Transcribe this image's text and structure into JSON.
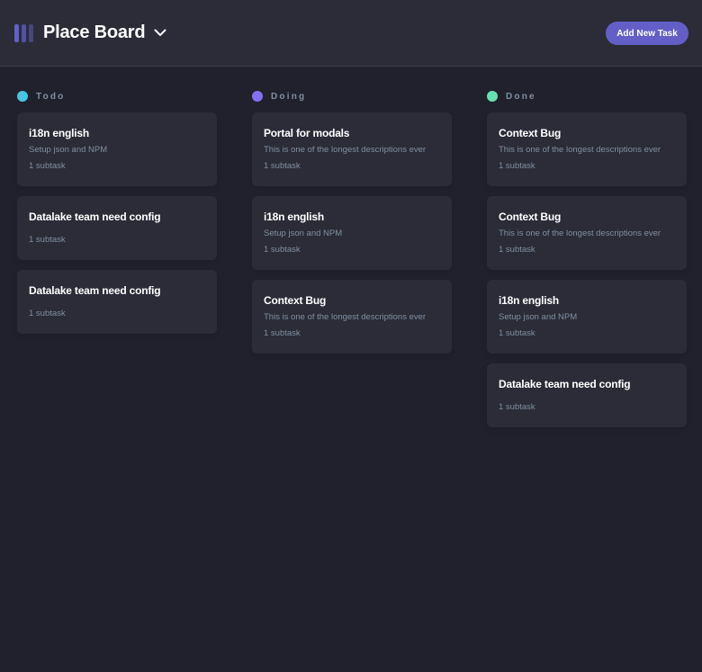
{
  "header": {
    "title": "Place Board",
    "add_task_label": "Add New Task",
    "logo_icon": "board-logo-icon",
    "dropdown_icon": "chevron-down-icon"
  },
  "columns": [
    {
      "name": "Todo",
      "color": "#49c4e5",
      "tasks": [
        {
          "title": "i18n english",
          "description": "Setup json and NPM",
          "subtasks": "1 subtask"
        },
        {
          "title": "Datalake team need config",
          "description": "",
          "subtasks": "1 subtask"
        },
        {
          "title": "Datalake team need config",
          "description": "",
          "subtasks": "1 subtask"
        }
      ]
    },
    {
      "name": "Doing",
      "color": "#8471f2",
      "tasks": [
        {
          "title": "Portal for modals",
          "description": "This is one of the longest descriptions ever",
          "subtasks": "1 subtask"
        },
        {
          "title": "i18n english",
          "description": "Setup json and NPM",
          "subtasks": "1 subtask"
        },
        {
          "title": "Context Bug",
          "description": "This is one of the longest descriptions ever",
          "subtasks": "1 subtask"
        }
      ]
    },
    {
      "name": "Done",
      "color": "#67e2ae",
      "tasks": [
        {
          "title": "Context Bug",
          "description": "This is one of the longest descriptions ever",
          "subtasks": "1 subtask"
        },
        {
          "title": "Context Bug",
          "description": "This is one of the longest descriptions ever",
          "subtasks": "1 subtask"
        },
        {
          "title": "i18n english",
          "description": "Setup json and NPM",
          "subtasks": "1 subtask"
        },
        {
          "title": "Datalake team need config",
          "description": "",
          "subtasks": "1 subtask"
        }
      ]
    }
  ]
}
